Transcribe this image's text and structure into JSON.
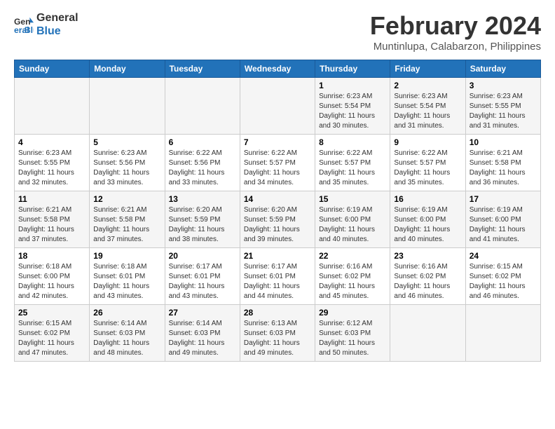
{
  "logo": {
    "line1": "General",
    "line2": "Blue"
  },
  "title": "February 2024",
  "subtitle": "Muntinlupa, Calabarzon, Philippines",
  "header": {
    "days": [
      "Sunday",
      "Monday",
      "Tuesday",
      "Wednesday",
      "Thursday",
      "Friday",
      "Saturday"
    ]
  },
  "weeks": [
    [
      {
        "day": "",
        "info": ""
      },
      {
        "day": "",
        "info": ""
      },
      {
        "day": "",
        "info": ""
      },
      {
        "day": "",
        "info": ""
      },
      {
        "day": "1",
        "info": "Sunrise: 6:23 AM\nSunset: 5:54 PM\nDaylight: 11 hours\nand 30 minutes."
      },
      {
        "day": "2",
        "info": "Sunrise: 6:23 AM\nSunset: 5:54 PM\nDaylight: 11 hours\nand 31 minutes."
      },
      {
        "day": "3",
        "info": "Sunrise: 6:23 AM\nSunset: 5:55 PM\nDaylight: 11 hours\nand 31 minutes."
      }
    ],
    [
      {
        "day": "4",
        "info": "Sunrise: 6:23 AM\nSunset: 5:55 PM\nDaylight: 11 hours\nand 32 minutes."
      },
      {
        "day": "5",
        "info": "Sunrise: 6:23 AM\nSunset: 5:56 PM\nDaylight: 11 hours\nand 33 minutes."
      },
      {
        "day": "6",
        "info": "Sunrise: 6:22 AM\nSunset: 5:56 PM\nDaylight: 11 hours\nand 33 minutes."
      },
      {
        "day": "7",
        "info": "Sunrise: 6:22 AM\nSunset: 5:57 PM\nDaylight: 11 hours\nand 34 minutes."
      },
      {
        "day": "8",
        "info": "Sunrise: 6:22 AM\nSunset: 5:57 PM\nDaylight: 11 hours\nand 35 minutes."
      },
      {
        "day": "9",
        "info": "Sunrise: 6:22 AM\nSunset: 5:57 PM\nDaylight: 11 hours\nand 35 minutes."
      },
      {
        "day": "10",
        "info": "Sunrise: 6:21 AM\nSunset: 5:58 PM\nDaylight: 11 hours\nand 36 minutes."
      }
    ],
    [
      {
        "day": "11",
        "info": "Sunrise: 6:21 AM\nSunset: 5:58 PM\nDaylight: 11 hours\nand 37 minutes."
      },
      {
        "day": "12",
        "info": "Sunrise: 6:21 AM\nSunset: 5:58 PM\nDaylight: 11 hours\nand 37 minutes."
      },
      {
        "day": "13",
        "info": "Sunrise: 6:20 AM\nSunset: 5:59 PM\nDaylight: 11 hours\nand 38 minutes."
      },
      {
        "day": "14",
        "info": "Sunrise: 6:20 AM\nSunset: 5:59 PM\nDaylight: 11 hours\nand 39 minutes."
      },
      {
        "day": "15",
        "info": "Sunrise: 6:19 AM\nSunset: 6:00 PM\nDaylight: 11 hours\nand 40 minutes."
      },
      {
        "day": "16",
        "info": "Sunrise: 6:19 AM\nSunset: 6:00 PM\nDaylight: 11 hours\nand 40 minutes."
      },
      {
        "day": "17",
        "info": "Sunrise: 6:19 AM\nSunset: 6:00 PM\nDaylight: 11 hours\nand 41 minutes."
      }
    ],
    [
      {
        "day": "18",
        "info": "Sunrise: 6:18 AM\nSunset: 6:00 PM\nDaylight: 11 hours\nand 42 minutes."
      },
      {
        "day": "19",
        "info": "Sunrise: 6:18 AM\nSunset: 6:01 PM\nDaylight: 11 hours\nand 43 minutes."
      },
      {
        "day": "20",
        "info": "Sunrise: 6:17 AM\nSunset: 6:01 PM\nDaylight: 11 hours\nand 43 minutes."
      },
      {
        "day": "21",
        "info": "Sunrise: 6:17 AM\nSunset: 6:01 PM\nDaylight: 11 hours\nand 44 minutes."
      },
      {
        "day": "22",
        "info": "Sunrise: 6:16 AM\nSunset: 6:02 PM\nDaylight: 11 hours\nand 45 minutes."
      },
      {
        "day": "23",
        "info": "Sunrise: 6:16 AM\nSunset: 6:02 PM\nDaylight: 11 hours\nand 46 minutes."
      },
      {
        "day": "24",
        "info": "Sunrise: 6:15 AM\nSunset: 6:02 PM\nDaylight: 11 hours\nand 46 minutes."
      }
    ],
    [
      {
        "day": "25",
        "info": "Sunrise: 6:15 AM\nSunset: 6:02 PM\nDaylight: 11 hours\nand 47 minutes."
      },
      {
        "day": "26",
        "info": "Sunrise: 6:14 AM\nSunset: 6:03 PM\nDaylight: 11 hours\nand 48 minutes."
      },
      {
        "day": "27",
        "info": "Sunrise: 6:14 AM\nSunset: 6:03 PM\nDaylight: 11 hours\nand 49 minutes."
      },
      {
        "day": "28",
        "info": "Sunrise: 6:13 AM\nSunset: 6:03 PM\nDaylight: 11 hours\nand 49 minutes."
      },
      {
        "day": "29",
        "info": "Sunrise: 6:12 AM\nSunset: 6:03 PM\nDaylight: 11 hours\nand 50 minutes."
      },
      {
        "day": "",
        "info": ""
      },
      {
        "day": "",
        "info": ""
      }
    ]
  ]
}
